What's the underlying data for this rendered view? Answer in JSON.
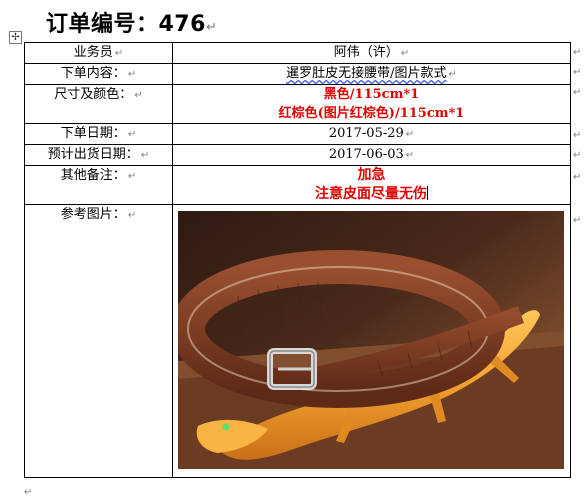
{
  "header": {
    "title": "订单编号：476"
  },
  "rows": [
    {
      "label": "业务员",
      "value": "阿伟（许）"
    },
    {
      "label": "下单内容：",
      "value": "暹罗肚皮无接腰带/图片款式"
    },
    {
      "label": "尺寸及颜色：",
      "values": [
        "黑色/115cm*1",
        "红棕色(图片红棕色)/115cm*1"
      ]
    },
    {
      "label": "下单日期：",
      "value": "2017-05-29"
    },
    {
      "label": "预计出货日期：",
      "value": "2017-06-03"
    },
    {
      "label": "其他备注：",
      "values": [
        "加急",
        "注意皮面尽量无伤"
      ]
    },
    {
      "label": "参考图片："
    }
  ],
  "photo": {
    "subject": "brown crocodile leather belt with silver buckle resting on an orange crocodile figurine",
    "belt_color": "#7a3a22",
    "croc_color": "#f0a030"
  }
}
